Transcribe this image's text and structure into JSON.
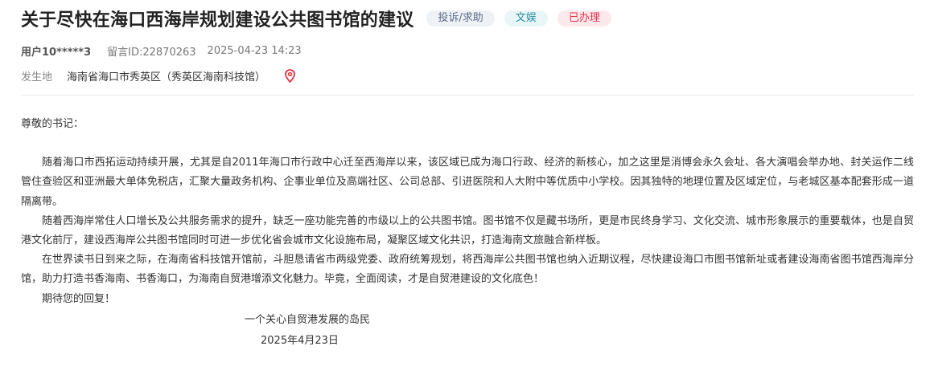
{
  "header": {
    "title": "关于尽快在海口西海岸规划建设公共图书馆的建议",
    "tags": {
      "type": "投诉/求助",
      "category": "文娱",
      "status": "已办理"
    }
  },
  "meta": {
    "user": "用户10*****3",
    "message_id": "留言ID:22870263",
    "datetime": "2025-04-23 14:23"
  },
  "location": {
    "label": "发生地",
    "value": "海南省海口市秀英区（秀英区海南科技馆）",
    "icon": "location-pin-icon"
  },
  "letter": {
    "greeting": "尊敬的书记：",
    "paragraphs": [
      "随着海口市西拓运动持续开展，尤其是自2011年海口市行政中心迁至西海岸以来，该区域已成为海口行政、经济的新核心，加之这里是消博会永久会址、各大演唱会举办地、封关运作二线管住查验区和亚洲最大单体免税店，汇聚大量政务机构、企事业单位及高端社区、公司总部、引进医院和人大附中等优质中小学校。因其独特的地理位置及区域定位，与老城区基本配套形成一道隔离带。",
      "随着西海岸常住人口增长及公共服务需求的提升，缺乏一座功能完善的市级以上的公共图书馆。图书馆不仅是藏书场所，更是市民终身学习、文化交流、城市形象展示的重要载体，也是自贸港文化前厅，建设西海岸公共图书馆同时可进一步优化省会城市文化设施布局，凝聚区域文化共识，打造海南文旅融合新样板。",
      " 在世界读书日到来之际，在海南省科技馆开馆前，斗胆恳请省市两级党委、政府统筹规划，将西海岸公共图书馆也纳入近期议程，尽快建设海口市图书馆新址或者建设海南省图书馆西海岸分馆，助力打造书香海南、书香海口，为海南自贸港增添文化魅力。毕竟，全面阅读，才是自贸港建设的文化底色！"
    ],
    "closing": "期待您的回复！",
    "signature": "一个关心自贸港发展的岛民",
    "date": "2025年4月23日"
  },
  "colors": {
    "status_red": "#e0344f",
    "category_teal": "#2a8da0",
    "type_gray": "#5b6b86",
    "pin_red": "#e8333f"
  }
}
